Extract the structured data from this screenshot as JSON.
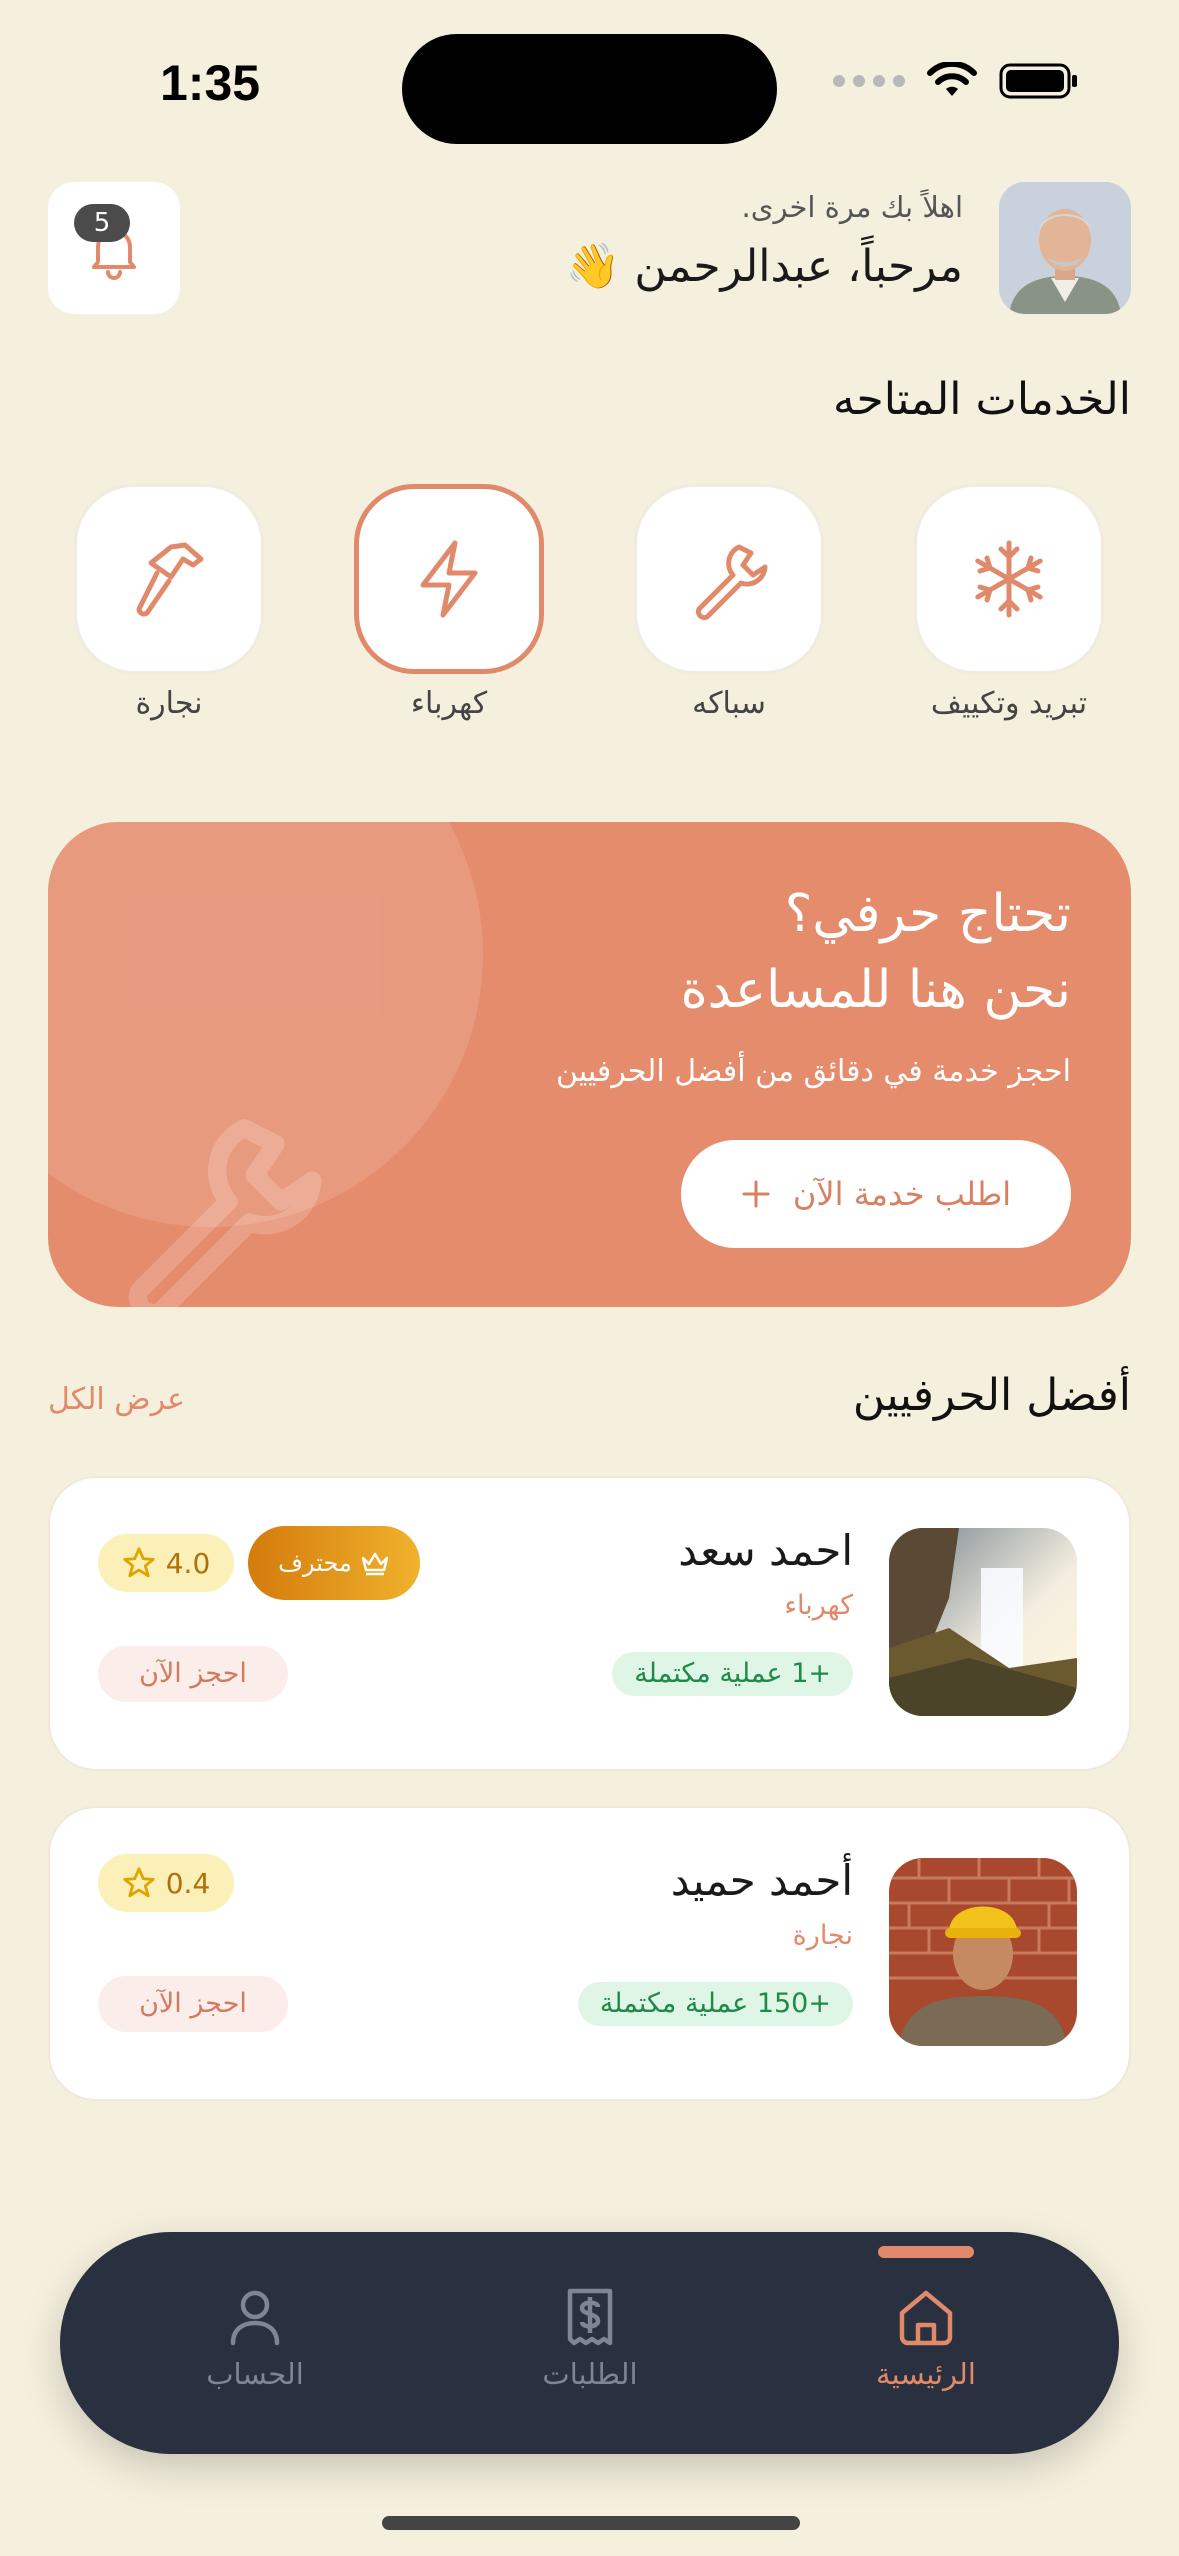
{
  "status_bar": {
    "time": "1:35"
  },
  "header": {
    "notification_count": "5",
    "greeting_sub": "اهلاً بك مرة اخرى.",
    "greeting_main": "مرحباً، عبدالرحمن 👋"
  },
  "services": {
    "title": "الخدمات المتاحه",
    "items": [
      {
        "label": "تبريد وتكييف",
        "icon": "snowflake-icon"
      },
      {
        "label": "سباكه",
        "icon": "wrench-icon"
      },
      {
        "label": "كهرباء",
        "icon": "lightning-icon",
        "selected": true
      },
      {
        "label": "نجارة",
        "icon": "hammer-icon"
      }
    ]
  },
  "promo": {
    "line1": "تحتاج حرفي؟",
    "line2": "نحن هنا للمساعدة",
    "line3": "احجز خدمة في دقائق من أفضل الحرفيين",
    "button_label": "اطلب خدمة الآن"
  },
  "top_craftsmen": {
    "title": "أفضل الحرفيين",
    "see_all": "عرض الكل",
    "items": [
      {
        "name": "احمد سعد",
        "trade": "كهرباء",
        "completed": "+1 عملية مكتملة",
        "rating": "4.0",
        "badge": "محترف",
        "book_label": "احجز الآن"
      },
      {
        "name": "أحمد حميد",
        "trade": "نجارة",
        "completed": "+150 عملية مكتملة",
        "rating": "0.4",
        "book_label": "احجز الآن"
      }
    ]
  },
  "nav": {
    "items": [
      {
        "label": "الرئيسية",
        "active": true
      },
      {
        "label": "الطلبات"
      },
      {
        "label": "الحساب"
      }
    ]
  },
  "colors": {
    "accent": "#e08a6b",
    "background": "#f5efdd",
    "nav": "#29303f"
  }
}
